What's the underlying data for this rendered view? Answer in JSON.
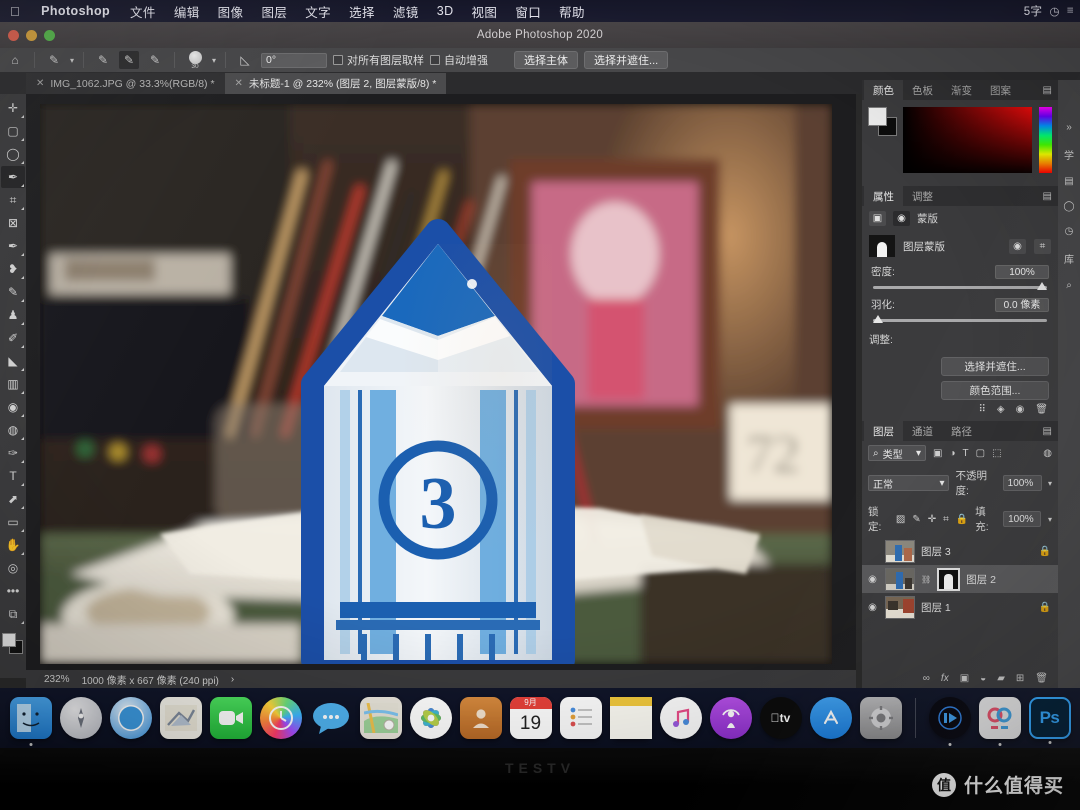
{
  "menubar": {
    "apple_icon": "apple-icon",
    "app_name": "Photoshop",
    "items": [
      "文件",
      "编辑",
      "图像",
      "图层",
      "文字",
      "选择",
      "滤镜",
      "3D",
      "视图",
      "窗口",
      "帮助"
    ],
    "right_items": [
      "5字",
      "clock-icon"
    ]
  },
  "titlebar": {
    "title": "Adobe Photoshop 2020"
  },
  "options_bar": {
    "home_icon": "home-icon",
    "preset_label": "brush-preset",
    "modes": [
      "new-selection-icon",
      "add-selection-icon",
      "subtract-selection-icon"
    ],
    "brush_size": "30",
    "angle_value": "0°",
    "checkbox_sample_all": "对所有图层取样",
    "checkbox_auto_enhance": "自动增强",
    "select_subject": "选择主体",
    "select_and_mask": "选择并遮住..."
  },
  "tabs": [
    {
      "label": "IMG_1062.JPG @ 33.3%(RGB/8) *",
      "active": false
    },
    {
      "label": "未标题-1 @ 232% (图层 2, 图层蒙版/8) *",
      "active": true
    }
  ],
  "toolbar": {
    "tools": [
      {
        "name": "move-tool",
        "glyph": "✛"
      },
      {
        "name": "marquee-tool",
        "glyph": "▢"
      },
      {
        "name": "lasso-tool",
        "glyph": "◯"
      },
      {
        "name": "quick-selection-tool",
        "glyph": "✎",
        "active": true
      },
      {
        "name": "crop-tool",
        "glyph": "⌗"
      },
      {
        "name": "frame-tool",
        "glyph": "⊠"
      },
      {
        "name": "eyedropper-tool",
        "glyph": "✒"
      },
      {
        "name": "healing-brush-tool",
        "glyph": "❧"
      },
      {
        "name": "brush-tool",
        "glyph": "🖌"
      },
      {
        "name": "clone-stamp-tool",
        "glyph": "♜"
      },
      {
        "name": "history-brush-tool",
        "glyph": "✑"
      },
      {
        "name": "eraser-tool",
        "glyph": "◣"
      },
      {
        "name": "gradient-tool",
        "glyph": "▦"
      },
      {
        "name": "blur-tool",
        "glyph": "💧"
      },
      {
        "name": "dodge-tool",
        "glyph": "🔍"
      },
      {
        "name": "pen-tool",
        "glyph": "✐"
      },
      {
        "name": "type-tool",
        "glyph": "T"
      },
      {
        "name": "path-selection-tool",
        "glyph": "⬉"
      },
      {
        "name": "rectangle-tool",
        "glyph": "▭"
      },
      {
        "name": "hand-tool",
        "glyph": "✋"
      },
      {
        "name": "zoom-tool",
        "glyph": "🔎"
      },
      {
        "name": "edit-toolbar-tool",
        "glyph": "•••"
      },
      {
        "name": "screen-mode-tool",
        "glyph": "⧉"
      }
    ],
    "foreground_color": "#e8e8e8",
    "background_color": "#101010"
  },
  "status_bar": {
    "zoom": "232%",
    "doc_info": "1000 像素 x 667 像素 (240 ppi)",
    "arrow": "›"
  },
  "color_panel": {
    "tabs": [
      "颜色",
      "色板",
      "渐变",
      "图案"
    ],
    "active_tab": "颜色",
    "menu_icon": "panel-menu-icon"
  },
  "properties_panel": {
    "tabs": [
      "属性",
      "调整"
    ],
    "active_tab": "属性",
    "mode_label": "蒙版",
    "mask_name": "图层蒙版",
    "density_label": "密度:",
    "density_value": "100%",
    "feather_label": "羽化:",
    "feather_value": "0.0 像素",
    "adjust_label": "调整:",
    "select_and_mask_button": "选择并遮住...",
    "color_range_button": "颜色范围...",
    "footer_icons": [
      "load-selection-icon",
      "apply-mask-icon",
      "toggle-mask-icon",
      "delete-mask-icon"
    ]
  },
  "layers_panel": {
    "tabs": [
      "图层",
      "通道",
      "路径"
    ],
    "active_tab": "图层",
    "filter_label": "类型",
    "filter_icons": [
      "pixel-filter-icon",
      "adjustment-filter-icon",
      "type-filter-icon",
      "shape-filter-icon",
      "smart-object-filter-icon"
    ],
    "blend_mode": "正常",
    "opacity_label": "不透明度:",
    "opacity_value": "100%",
    "lock_label": "锁定:",
    "lock_icons": [
      "lock-transparent-icon",
      "lock-image-icon",
      "lock-position-icon",
      "lock-artboard-icon",
      "lock-all-icon"
    ],
    "fill_label": "填充:",
    "fill_value": "100%",
    "layers": [
      {
        "name": "图层 3",
        "visible": false,
        "locked": true,
        "selected": false,
        "has_mask": false
      },
      {
        "name": "图层 2",
        "visible": true,
        "locked": false,
        "selected": true,
        "has_mask": true
      },
      {
        "name": "图层 1",
        "visible": true,
        "locked": true,
        "selected": false,
        "has_mask": false
      }
    ],
    "footer_icons": [
      "link-layers-icon",
      "layer-style-icon",
      "add-mask-icon",
      "adjustment-layer-icon",
      "new-group-icon",
      "new-layer-icon",
      "delete-layer-icon"
    ]
  },
  "right_rail": {
    "items": [
      "学",
      "库"
    ]
  },
  "dock": {
    "icons": [
      {
        "name": "finder-icon",
        "label": "Finder"
      },
      {
        "name": "launchpad-icon",
        "label": "Launchpad"
      },
      {
        "name": "safari-icon",
        "label": "Safari"
      },
      {
        "name": "mail-icon",
        "label": "Mail"
      },
      {
        "name": "facetime-icon",
        "label": "FaceTime"
      },
      {
        "name": "siri-icon",
        "label": "Siri"
      },
      {
        "name": "messages-icon",
        "label": "Messages"
      },
      {
        "name": "maps-icon",
        "label": "Maps"
      },
      {
        "name": "photos-icon",
        "label": "Photos"
      },
      {
        "name": "contacts-icon",
        "label": "Contacts"
      },
      {
        "name": "calendar-icon",
        "label": "Calendar",
        "month": "9月",
        "day": "19"
      },
      {
        "name": "reminders-icon",
        "label": "Reminders"
      },
      {
        "name": "notes-icon",
        "label": "Notes"
      },
      {
        "name": "music-icon",
        "label": "Music"
      },
      {
        "name": "podcasts-icon",
        "label": "Podcasts"
      },
      {
        "name": "appletv-icon",
        "label": "Apple TV"
      },
      {
        "name": "appstore-icon",
        "label": "App Store"
      },
      {
        "name": "system-preferences-icon",
        "label": "System Preferences"
      },
      {
        "name": "media-player-icon",
        "label": "IINA"
      },
      {
        "name": "creative-cloud-icon",
        "label": "Creative Cloud"
      },
      {
        "name": "photoshop-icon",
        "label": "Ps"
      }
    ]
  },
  "monitor": {
    "brand": "TESTV"
  },
  "watermark": {
    "logo": "值",
    "text": "什么值得买"
  },
  "artwork": {
    "description": "painted blue pencil house illustration over blurred desk photo",
    "pencil_number": "3",
    "colors": {
      "outline": "#1b4fa8",
      "body": "#e9eef3",
      "stripe": "#5ba3dc",
      "tip": "#1665b8"
    }
  }
}
